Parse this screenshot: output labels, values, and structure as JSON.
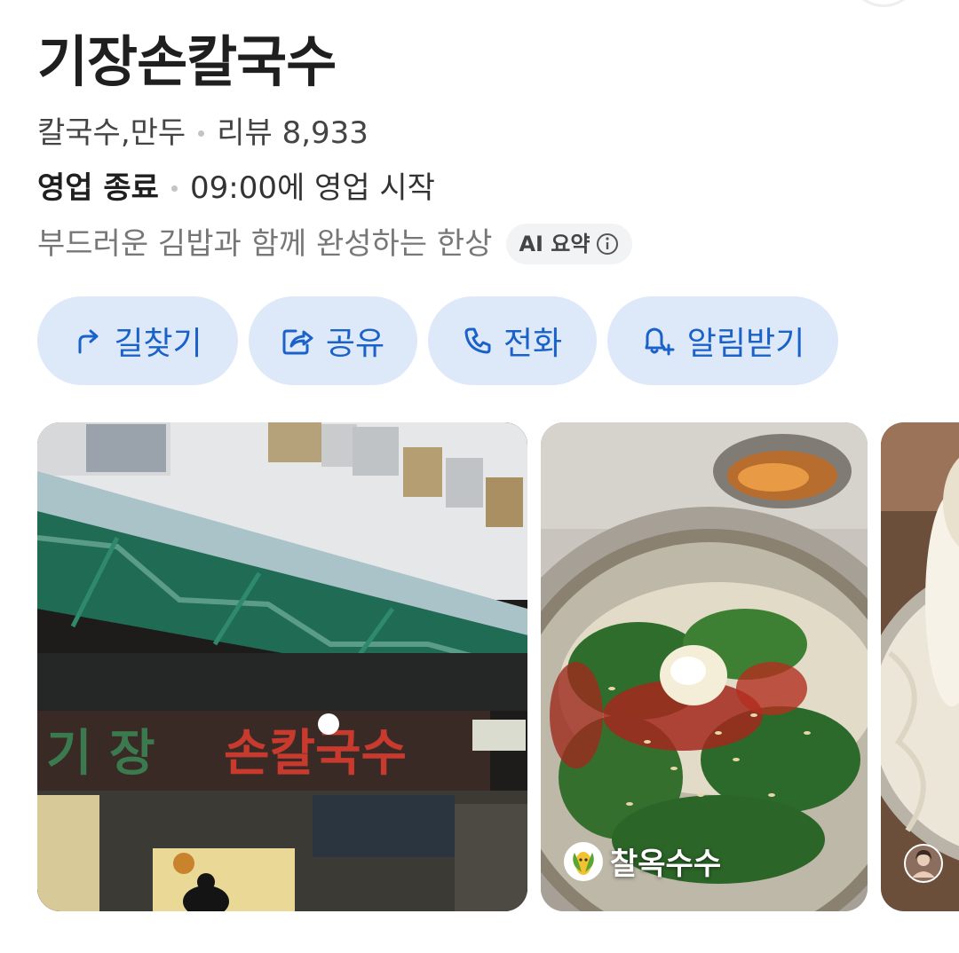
{
  "place": {
    "name": "기장손칼국수",
    "category": "칼국수,만두",
    "review_label": "리뷰 8,933",
    "status": "영업 종료",
    "next_open": "09:00에 영업 시작",
    "summary": "부드러운 김밥과 함께 완성하는 한상",
    "ai_badge": "AI 요약"
  },
  "actions": [
    {
      "label": "길찾기",
      "icon": "directions-icon"
    },
    {
      "label": "공유",
      "icon": "share-icon"
    },
    {
      "label": "전화",
      "icon": "phone-icon"
    },
    {
      "label": "알림받기",
      "icon": "bell-plus-icon"
    }
  ],
  "photos": [
    {
      "subject": "storefront",
      "sign_text": "기장손칼국수"
    },
    {
      "subject": "kalguksu-bowl",
      "credit": "찰옥수수"
    },
    {
      "subject": "noodle-closeup",
      "credit": ""
    }
  ],
  "colors": {
    "accent": "#1a62c9",
    "button_bg": "#dde9f8"
  }
}
